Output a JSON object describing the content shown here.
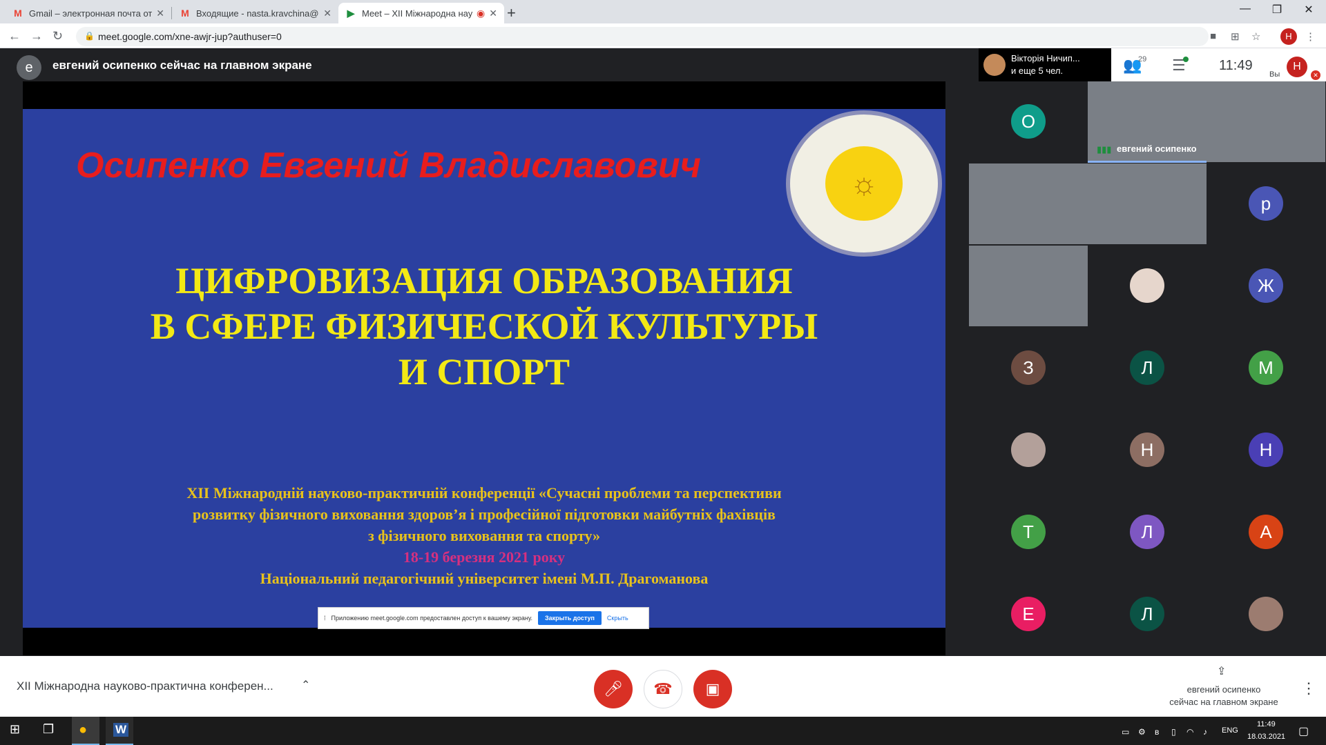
{
  "browser": {
    "tabs": [
      {
        "icon": "M",
        "title": "Gmail – электронная почта от G"
      },
      {
        "icon": "M",
        "title": "Входящие - nasta.kravchina@gm"
      },
      {
        "icon": "▶",
        "title": "Meet – XII Міжнародна нау"
      }
    ],
    "new_tab": "+",
    "url": "meet.google.com/xne-awjr-jup?authuser=0",
    "profile_initial": "H"
  },
  "meet": {
    "presenter_initial": "е",
    "presenter_banner": "евгений осипенко сейчас на главном экране",
    "speaker_name": "Вікторія Ничип...",
    "speaker_more": "и еще 5 чел.",
    "people_count": "29",
    "clock": "11:49",
    "me_initial": "H",
    "me_label": "Вы",
    "active_tile_name": "евгений осипенко",
    "tiles": [
      {
        "kind": "avatar",
        "letter": "О",
        "color": "#0f9d8a"
      },
      {
        "kind": "video"
      },
      {
        "kind": "video"
      },
      {
        "kind": "video"
      },
      {
        "kind": "video"
      },
      {
        "kind": "avatar",
        "letter": "р",
        "color": "#4a56b5"
      },
      {
        "kind": "video"
      },
      {
        "kind": "photo",
        "color": "#e6d6cc"
      },
      {
        "kind": "avatar",
        "letter": "Ж",
        "color": "#4a56b5"
      },
      {
        "kind": "avatar",
        "letter": "З",
        "color": "#6d4c41"
      },
      {
        "kind": "avatar",
        "letter": "Л",
        "color": "#0b5345"
      },
      {
        "kind": "avatar",
        "letter": "М",
        "color": "#43a047"
      },
      {
        "kind": "photo",
        "color": "#b3a09a"
      },
      {
        "kind": "avatar",
        "letter": "Н",
        "color": "#8d6e63"
      },
      {
        "kind": "avatar",
        "letter": "Н",
        "color": "#4a3fb5"
      },
      {
        "kind": "avatar",
        "letter": "Т",
        "color": "#43a047"
      },
      {
        "kind": "avatar",
        "letter": "Л",
        "color": "#7e57c2"
      },
      {
        "kind": "avatar",
        "letter": "А",
        "color": "#d84315"
      },
      {
        "kind": "avatar",
        "letter": "Е",
        "color": "#e91e63"
      },
      {
        "kind": "avatar",
        "letter": "Л",
        "color": "#0b5345"
      },
      {
        "kind": "photo",
        "color": "#9c7c70"
      }
    ]
  },
  "slide": {
    "name": "Осипенко Евгений Владиславович",
    "title_line1": "ЦИФРОВИЗАЦИЯ ОБРАЗОВАНИЯ",
    "title_line2": "В СФЕРЕ ФИЗИЧЕСКОЙ КУЛЬТУРЫ",
    "title_line3": "И СПОРТ",
    "conf_line1": "XII Міжнародній науково-практичній конференції «Сучасні проблеми та перспективи",
    "conf_line2": "розвитку фізичного виховання здоров’я і професійної підготовки майбутніх фахівців",
    "conf_line3": "з фізичного виховання та спорту»",
    "date": "18-19 березня 2021 року",
    "university": "Національний педагогічний університет імені М.П. Драгоманова"
  },
  "sharebar": {
    "message": "Приложению meet.google.com предоставлен доступ к вашему экрану.",
    "stop": "Закрыть доступ",
    "hide": "Скрыть"
  },
  "bottom": {
    "meeting_title": "XII Міжнародна науково-практична конферен...",
    "presenter_line1": "евгений осипенко",
    "presenter_line2": "сейчас на главном экране"
  },
  "taskbar": {
    "lang": "ENG",
    "time": "11:49",
    "date": "18.03.2021"
  },
  "colors": {
    "slide_bg": "#2b40a0",
    "slide_name": "#e81d1d",
    "slide_title": "#f3e915",
    "danger": "#d93025"
  }
}
